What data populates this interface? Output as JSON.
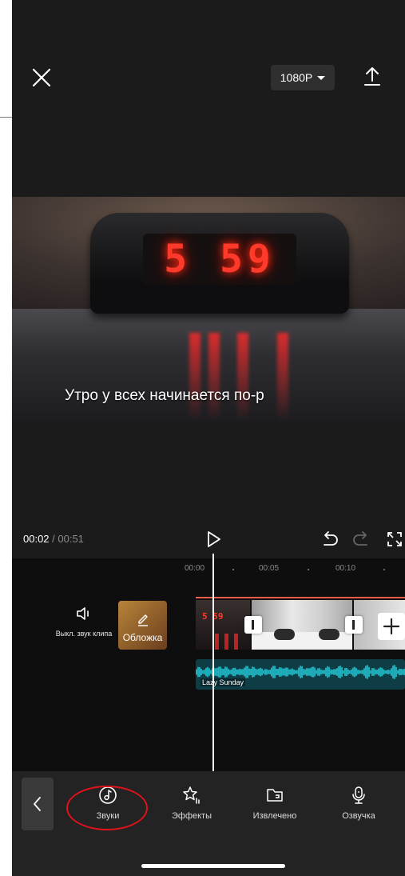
{
  "top_bar": {
    "resolution": "1080P"
  },
  "preview": {
    "clock_display": "5 59",
    "subtitle": "Утро у всех начинается по-р"
  },
  "playback": {
    "current_time": "00:02",
    "total_time": " / 00:51"
  },
  "timeline": {
    "ruler": [
      "00:00",
      "00:05",
      "00:10"
    ],
    "mute_label": "Выкл. звук клипа",
    "cover_label": "Обложка",
    "clip1_digits": "5 59",
    "audio_label": "Lazy Sunday"
  },
  "toolbar": {
    "tools": [
      {
        "label": "Звуки",
        "icon": "music-note-icon"
      },
      {
        "label": "Эффекты",
        "icon": "star-sparkle-icon"
      },
      {
        "label": "Извлечено",
        "icon": "folder-icon"
      },
      {
        "label": "Озвучка",
        "icon": "microphone-icon"
      }
    ]
  },
  "colors": {
    "accent_red": "#e0121b",
    "led_red": "#ff3a2a",
    "audio_wave": "#22c6d2"
  }
}
